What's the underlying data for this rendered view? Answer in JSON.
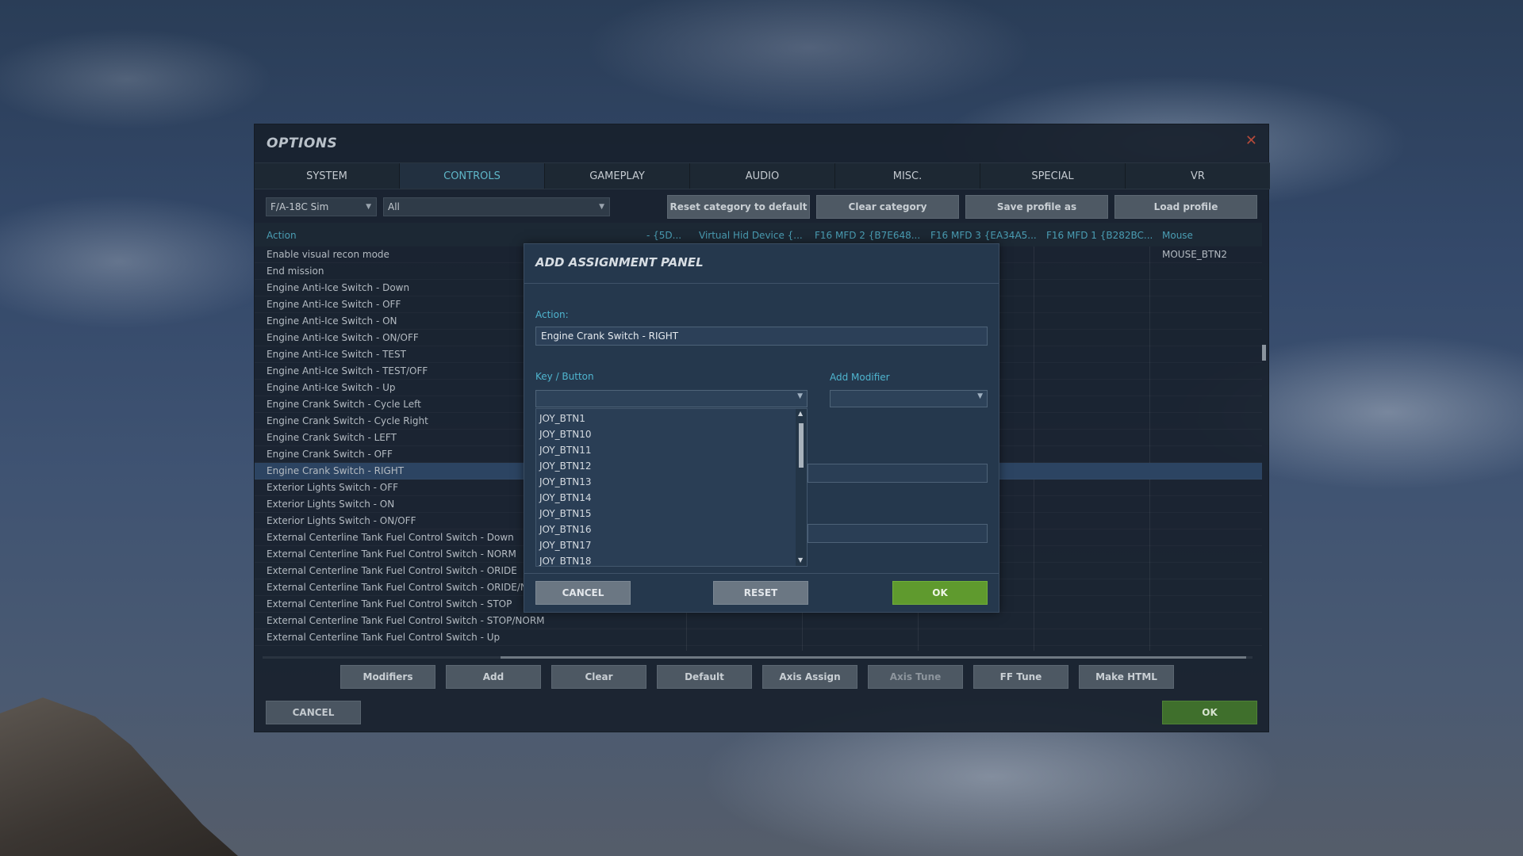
{
  "window": {
    "title": "OPTIONS",
    "close_glyph": "✕"
  },
  "tabs": [
    "SYSTEM",
    "CONTROLS",
    "GAMEPLAY",
    "AUDIO",
    "MISC.",
    "SPECIAL",
    "VR"
  ],
  "toolbar": {
    "aircraft_select": "F/A-18C Sim",
    "category_select": "All",
    "reset_category": "Reset category to default",
    "clear_category": "Clear category",
    "save_profile": "Save profile as",
    "load_profile": "Load profile"
  },
  "grid": {
    "headers": {
      "action": "Action",
      "col1": "- {5D...",
      "col2": "Virtual Hid Device {...",
      "col3": "F16 MFD 2 {B7E648...",
      "col4": "F16 MFD 3 {EA34A5...",
      "col5": "F16 MFD 1 {B282BC...",
      "mouse": "Mouse"
    },
    "rows": [
      {
        "name": "Enable visual recon mode",
        "mouse": "MOUSE_BTN2"
      },
      {
        "name": "End mission",
        "mouse": ""
      },
      {
        "name": "Engine Anti-Ice Switch - Down",
        "mouse": ""
      },
      {
        "name": "Engine Anti-Ice Switch - OFF",
        "mouse": ""
      },
      {
        "name": "Engine Anti-Ice Switch - ON",
        "mouse": ""
      },
      {
        "name": "Engine Anti-Ice Switch - ON/OFF",
        "mouse": ""
      },
      {
        "name": "Engine Anti-Ice Switch - TEST",
        "mouse": ""
      },
      {
        "name": "Engine Anti-Ice Switch - TEST/OFF",
        "mouse": ""
      },
      {
        "name": "Engine Anti-Ice Switch - Up",
        "mouse": ""
      },
      {
        "name": "Engine Crank Switch - Cycle Left",
        "mouse": ""
      },
      {
        "name": "Engine Crank Switch - Cycle Right",
        "mouse": ""
      },
      {
        "name": "Engine Crank Switch - LEFT",
        "mouse": ""
      },
      {
        "name": "Engine Crank Switch - OFF",
        "mouse": ""
      },
      {
        "name": "Engine Crank Switch - RIGHT",
        "mouse": ""
      },
      {
        "name": "Exterior Lights Switch - OFF",
        "mouse": ""
      },
      {
        "name": "Exterior Lights Switch - ON",
        "mouse": ""
      },
      {
        "name": "Exterior Lights Switch - ON/OFF",
        "mouse": ""
      },
      {
        "name": "External Centerline Tank Fuel Control Switch - Down",
        "mouse": ""
      },
      {
        "name": "External Centerline Tank Fuel Control Switch - NORM",
        "mouse": ""
      },
      {
        "name": "External Centerline Tank Fuel Control Switch - ORIDE",
        "mouse": ""
      },
      {
        "name": "External Centerline Tank Fuel Control Switch - ORIDE/NORM",
        "mouse": ""
      },
      {
        "name": "External Centerline Tank Fuel Control Switch - STOP",
        "mouse": ""
      },
      {
        "name": "External Centerline Tank Fuel Control Switch - STOP/NORM",
        "mouse": ""
      },
      {
        "name": "External Centerline Tank Fuel Control Switch - Up",
        "mouse": ""
      }
    ]
  },
  "bottom_buttons": [
    "Modifiers",
    "Add",
    "Clear",
    "Default",
    "Axis Assign",
    "Axis Tune",
    "FF Tune",
    "Make HTML"
  ],
  "footer": {
    "cancel": "CANCEL",
    "ok": "OK"
  },
  "dialog": {
    "title": "ADD ASSIGNMENT PANEL",
    "action_label": "Action:",
    "action_value": "Engine Crank Switch - RIGHT",
    "key_label": "Key / Button",
    "modifier_label": "Add Modifier",
    "key_options": [
      "JOY_BTN1",
      "JOY_BTN10",
      "JOY_BTN11",
      "JOY_BTN12",
      "JOY_BTN13",
      "JOY_BTN14",
      "JOY_BTN15",
      "JOY_BTN16",
      "JOY_BTN17",
      "JOY_BTN18"
    ],
    "cancel": "CANCEL",
    "reset": "RESET",
    "ok": "OK"
  },
  "colors": {
    "accent": "#4fb5cf",
    "ok_green": "#5f9a2e",
    "selected_row": "#2c4462"
  }
}
